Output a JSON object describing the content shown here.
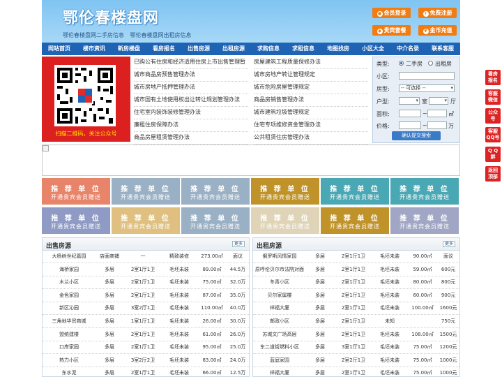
{
  "header": {
    "logo": "鄂伦春楼盘网",
    "taglines": [
      "鄂伦春楼盘网二手房信息",
      "鄂伦春楼盘网出租房信息"
    ],
    "buttons": [
      {
        "label": "会员登录",
        "icon": "user-icon"
      },
      {
        "label": "免费注册",
        "icon": "plus-icon"
      },
      {
        "label": "贵宾套餐",
        "icon": "diamond-icon"
      },
      {
        "label": "金币充值",
        "icon": "coin-icon"
      }
    ],
    "accent": "#f07c12"
  },
  "nav": [
    "网站首页",
    "楼市资讯",
    "新房楼盘",
    "看房报名",
    "出售房源",
    "出租房源",
    "求购信息",
    "求租信息",
    "地图找房",
    "小区大全",
    "中介名录",
    "联系客服"
  ],
  "qr": {
    "caption": "扫描二维码，关注公众号",
    "icon": "qr-code-icon"
  },
  "links": [
    [
      "已购公有住房和经济适用住房上市出售管理暂",
      "房屋建筑工程质量保修办法"
    ],
    [
      "城市商品房预售管理办法",
      "城市房地产转让管理规定"
    ],
    [
      "城市房地产抵押管理办法",
      "城市危险房屋管理规定"
    ],
    [
      "城市国有土地使用权出让转让规划管理办法",
      "商品房销售管理办法"
    ],
    [
      "住宅室内装饰装修管理办法",
      "城市建筑垃圾管理规定"
    ],
    [
      "廉租住房保障办法",
      "住宅专项维修资金管理办法"
    ],
    [
      "商品房屋租赁管理办法",
      "公共租赁住房管理办法"
    ]
  ],
  "search": {
    "type_label": "类型:",
    "type_options": [
      "二手房",
      "出租房"
    ],
    "type_selected": "二手房",
    "community_label": "小区:",
    "community_value": "",
    "house_type_label": "房型:",
    "house_type_value": "-- 可选择 --",
    "layout_label": "户型:",
    "room_unit": "室",
    "hall_unit": "厅",
    "area_label": "面积:",
    "area_unit": "㎡",
    "price_label": "价格:",
    "range_sep": "~",
    "price_unit": "万",
    "submit": "确认提交搜索"
  },
  "tiles": {
    "line1": "推 荐 单 位",
    "line2": "开通贵宾会员赠送",
    "colors": [
      "#e8846a",
      "#9ab0c4",
      "#9ab0c4",
      "#c0932a",
      "#4aa8b4",
      "#4aa8b4",
      "#8f9bc4",
      "#e0c080",
      "#9ab0c4",
      "#e0d4b8",
      "#c0932a",
      "#a0a6c4"
    ]
  },
  "sale": {
    "title": "出售房源",
    "more": "更多",
    "rows": [
      [
        "大杨树世纪嘉园",
        "店面商铺",
        "一",
        "精致装修",
        "273.00㎡",
        "面议"
      ],
      [
        "海桥家园",
        "多层",
        "2室1厅1卫",
        "毛坯未装",
        "89.00㎡",
        "44.5万"
      ],
      [
        "木兰小区",
        "多层",
        "2室1厅1卫",
        "毛坯未装",
        "75.00㎡",
        "32.0万"
      ],
      [
        "金色家园",
        "多层",
        "2室1厅1卫",
        "毛坯未装",
        "87.00㎡",
        "35.0万"
      ],
      [
        "新区沁园",
        "多层",
        "3室2厅1卫",
        "毛坯未装",
        "110.00㎡",
        "40.0万"
      ],
      [
        "三角地华贸商城",
        "多层",
        "1室1厅1卫",
        "毛坯未装",
        "26.00㎡",
        "30.0万"
      ],
      [
        "盟统建楼",
        "多层",
        "2室1厅1卫",
        "毛坯未装",
        "61.00㎡",
        "26.0万"
      ],
      [
        "口岸家园",
        "多层",
        "2室1厅1卫",
        "毛坯未装",
        "95.00㎡",
        "25.0万"
      ],
      [
        "热力小区",
        "多层",
        "3室2厅2卫",
        "毛坯未装",
        "83.00㎡",
        "24.0万"
      ],
      [
        "东水泥",
        "多层",
        "2室1厅1卫",
        "毛坯未装",
        "66.00㎡",
        "12.5万"
      ]
    ]
  },
  "rent": {
    "title": "出租房源",
    "more": "更多",
    "rows": [
      [
        "俄罗斯风情家园",
        "多层",
        "2室1厅1卫",
        "毛坯未装",
        "90.00㎡",
        "面议"
      ],
      [
        "原呼伦贝尔市法院对面",
        "多层",
        "2室1厅1卫",
        "毛坯未装",
        "59.00㎡",
        "600元"
      ],
      [
        "冬青小区",
        "多层",
        "2室1厅1卫",
        "毛坯未装",
        "80.00㎡",
        "800元"
      ],
      [
        "贝尔家属楼",
        "多层",
        "2室1厅1卫",
        "毛坯未装",
        "60.00㎡",
        "900元"
      ],
      [
        "祥福大厦",
        "多层",
        "2室1厅1卫",
        "毛坯未装",
        "100.00㎡",
        "1600元"
      ],
      [
        "邮政小区",
        "多层",
        "2室1厅1卫",
        "未知",
        "",
        "750元"
      ],
      [
        "苏城文广场高层",
        "多层",
        "2室1厅1卫",
        "毛坯未装",
        "108.00㎡",
        "1500元"
      ],
      [
        "东二道街燃料小区",
        "多层",
        "3室1厅1卫",
        "毛坯未装",
        "75.00㎡",
        "1200元"
      ],
      [
        "蓝庭家园",
        "多层",
        "2室2厅1卫",
        "毛坯未装",
        "75.00㎡",
        "1000元"
      ],
      [
        "祥福大厦",
        "多层",
        "2室1厅1卫",
        "毛坯未装",
        "75.00㎡",
        "1000元"
      ]
    ]
  },
  "float": [
    {
      "l1": "看房",
      "l2": "报名"
    },
    {
      "l1": "客服",
      "l2": "微信"
    },
    {
      "l1": "公众",
      "l2": "号"
    },
    {
      "l1": "客服",
      "l2": "QQ号"
    },
    {
      "l1": "Q Q",
      "l2": "群"
    },
    {
      "l1": "返回",
      "l2": "顶部"
    }
  ]
}
